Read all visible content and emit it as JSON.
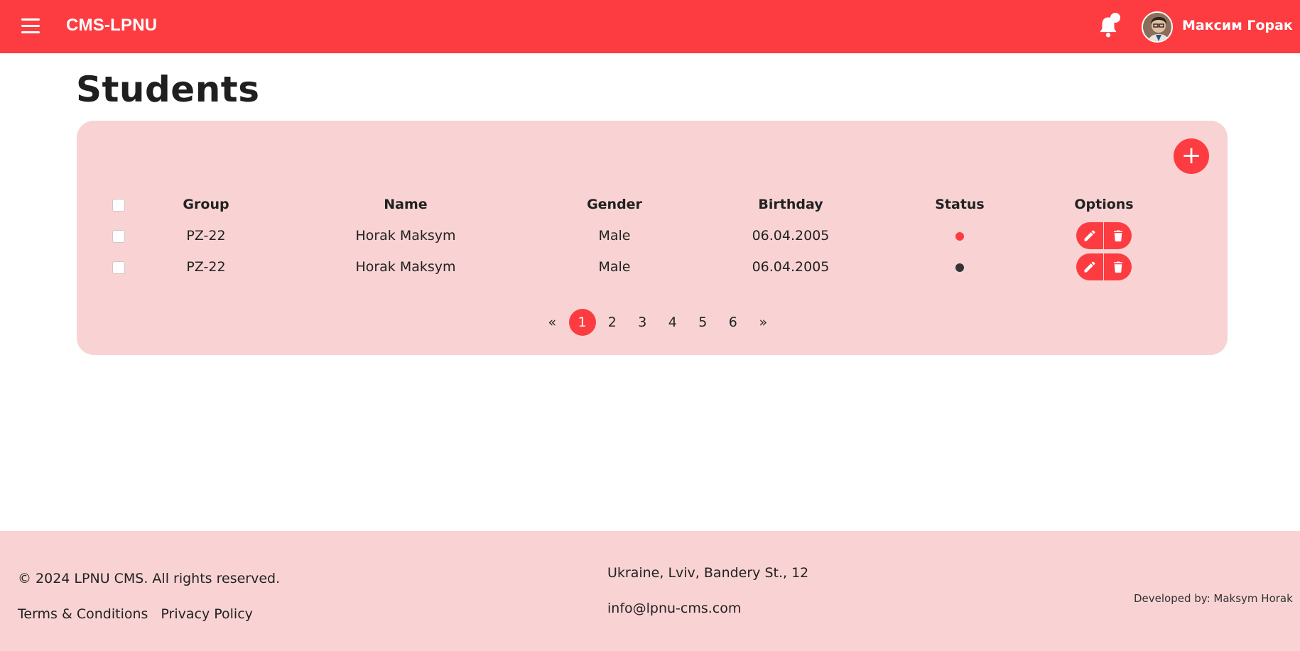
{
  "header": {
    "brand": "CMS-LPNU",
    "user_name": "Максим Горак",
    "accent_color": "#fd3c41"
  },
  "page": {
    "title": "Students"
  },
  "table": {
    "columns": [
      "Group",
      "Name",
      "Gender",
      "Birthday",
      "Status",
      "Options"
    ],
    "rows": [
      {
        "group": "PZ-22",
        "name": "Horak Maksym",
        "gender": "Male",
        "birthday": "06.04.2005",
        "status_color": "#fd3c41"
      },
      {
        "group": "PZ-22",
        "name": "Horak Maksym",
        "gender": "Male",
        "birthday": "06.04.2005",
        "status_color": "#333333"
      }
    ]
  },
  "pagination": {
    "prev": "«",
    "pages": [
      "1",
      "2",
      "3",
      "4",
      "5",
      "6"
    ],
    "active_page": "1",
    "next": "»"
  },
  "footer": {
    "copyright": "© 2024 LPNU CMS. All rights reserved.",
    "terms": "Terms & Conditions",
    "privacy": "Privacy Policy",
    "address": "Ukraine, Lviv, Bandery St., 12",
    "email": "info@lpnu-cms.com",
    "developer": "Developed by: Maksym Horak"
  },
  "icons": [
    "menu-icon",
    "bell-icon",
    "plus-icon",
    "pencil-icon",
    "trash-icon"
  ]
}
